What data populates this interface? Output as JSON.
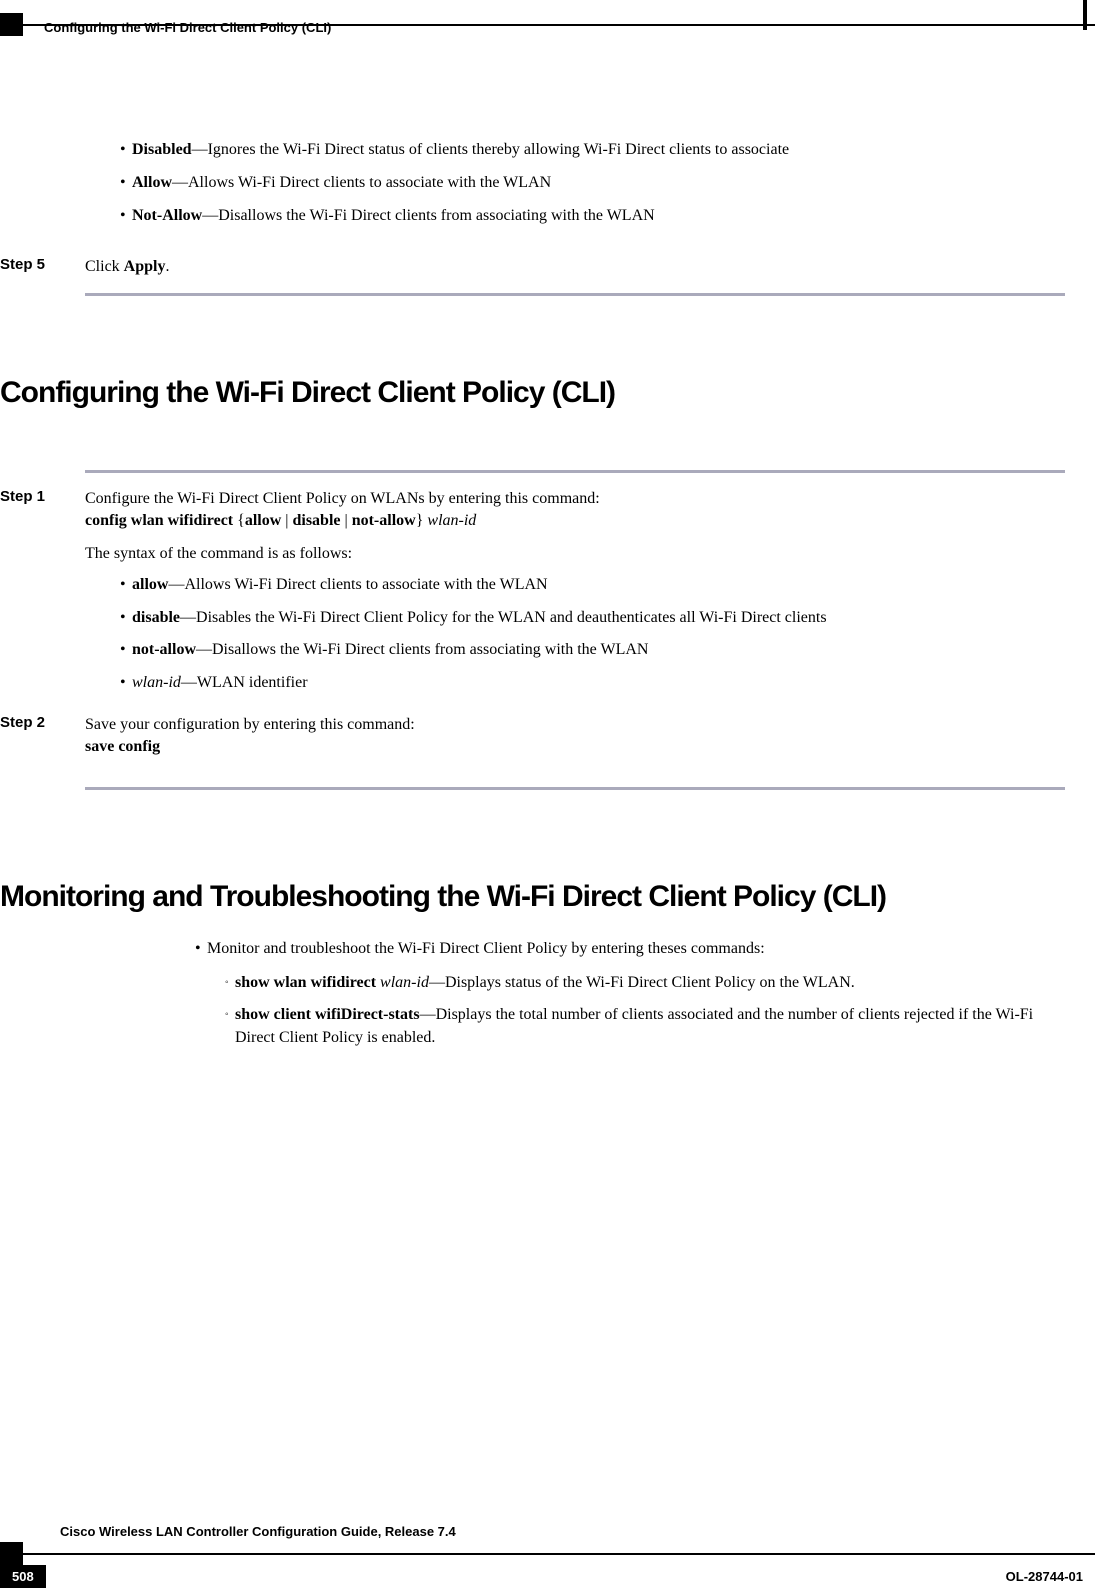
{
  "header": {
    "running_title": "Configuring the Wi-Fi Direct Client Policy (CLI)"
  },
  "prev_section": {
    "bullets": [
      {
        "label": "Disabled",
        "sep": "—",
        "text": "Ignores the Wi-Fi Direct status of clients thereby allowing Wi-Fi Direct clients to associate"
      },
      {
        "label": "Allow",
        "sep": "—",
        "text": "Allows Wi-Fi Direct clients to associate with the WLAN"
      },
      {
        "label": "Not-Allow",
        "sep": "—",
        "text": "Disallows the Wi-Fi Direct clients from associating with the WLAN"
      }
    ],
    "step5_label": "Step 5",
    "step5_prefix": "Click ",
    "step5_bold": "Apply",
    "step5_suffix": "."
  },
  "sectionA": {
    "heading": "Configuring the Wi-Fi Direct Client Policy (CLI)",
    "step1_label": "Step 1",
    "step1_line1": "Configure the Wi-Fi Direct Client Policy on WLANs by entering this command:",
    "step1_cmd_b1": "config wlan wifidirect",
    "step1_cmd_brace_open": " {",
    "step1_cmd_allow": "allow",
    "step1_cmd_pipe1": " | ",
    "step1_cmd_disable": "disable",
    "step1_cmd_pipe2": " | ",
    "step1_cmd_notallow": "not-allow",
    "step1_cmd_brace_close": "} ",
    "step1_cmd_ital": "wlan-id",
    "step1_syntax_intro": "The syntax of the command is as follows:",
    "bullets": [
      {
        "label": "allow",
        "sep": "—",
        "text": "Allows Wi-Fi Direct clients to associate with the WLAN",
        "italic": false
      },
      {
        "label": "disable",
        "sep": "—",
        "text": "Disables the Wi-Fi Direct Client Policy for the WLAN and deauthenticates all Wi-Fi Direct clients",
        "italic": false
      },
      {
        "label": "not-allow",
        "sep": "—",
        "text": "Disallows the Wi-Fi Direct clients from associating with the WLAN",
        "italic": false
      },
      {
        "label": "wlan-id",
        "sep": "—",
        "text": "WLAN identifier",
        "italic": true
      }
    ],
    "step2_label": "Step 2",
    "step2_line1": "Save your configuration by entering this command:",
    "step2_cmd": "save config"
  },
  "sectionB": {
    "heading": "Monitoring and Troubleshooting the Wi-Fi Direct Client Policy (CLI)",
    "outer_bullet": "Monitor and troubleshoot the Wi-Fi Direct Client Policy by entering theses commands:",
    "sub": [
      {
        "cmd_bold": "show wlan wifidirect ",
        "cmd_ital": "wlan-id",
        "sep": "—",
        "text": "Displays status of the Wi-Fi Direct Client Policy on the WLAN."
      },
      {
        "cmd_bold": "show client wifiDirect-stats",
        "cmd_ital": "",
        "sep": "—",
        "text": "Displays the total number of clients associated and the number of clients rejected if the Wi-Fi Direct Client Policy is enabled."
      }
    ]
  },
  "footer": {
    "guide": "Cisco Wireless LAN Controller Configuration Guide, Release 7.4",
    "page": "508",
    "docid": "OL-28744-01"
  }
}
